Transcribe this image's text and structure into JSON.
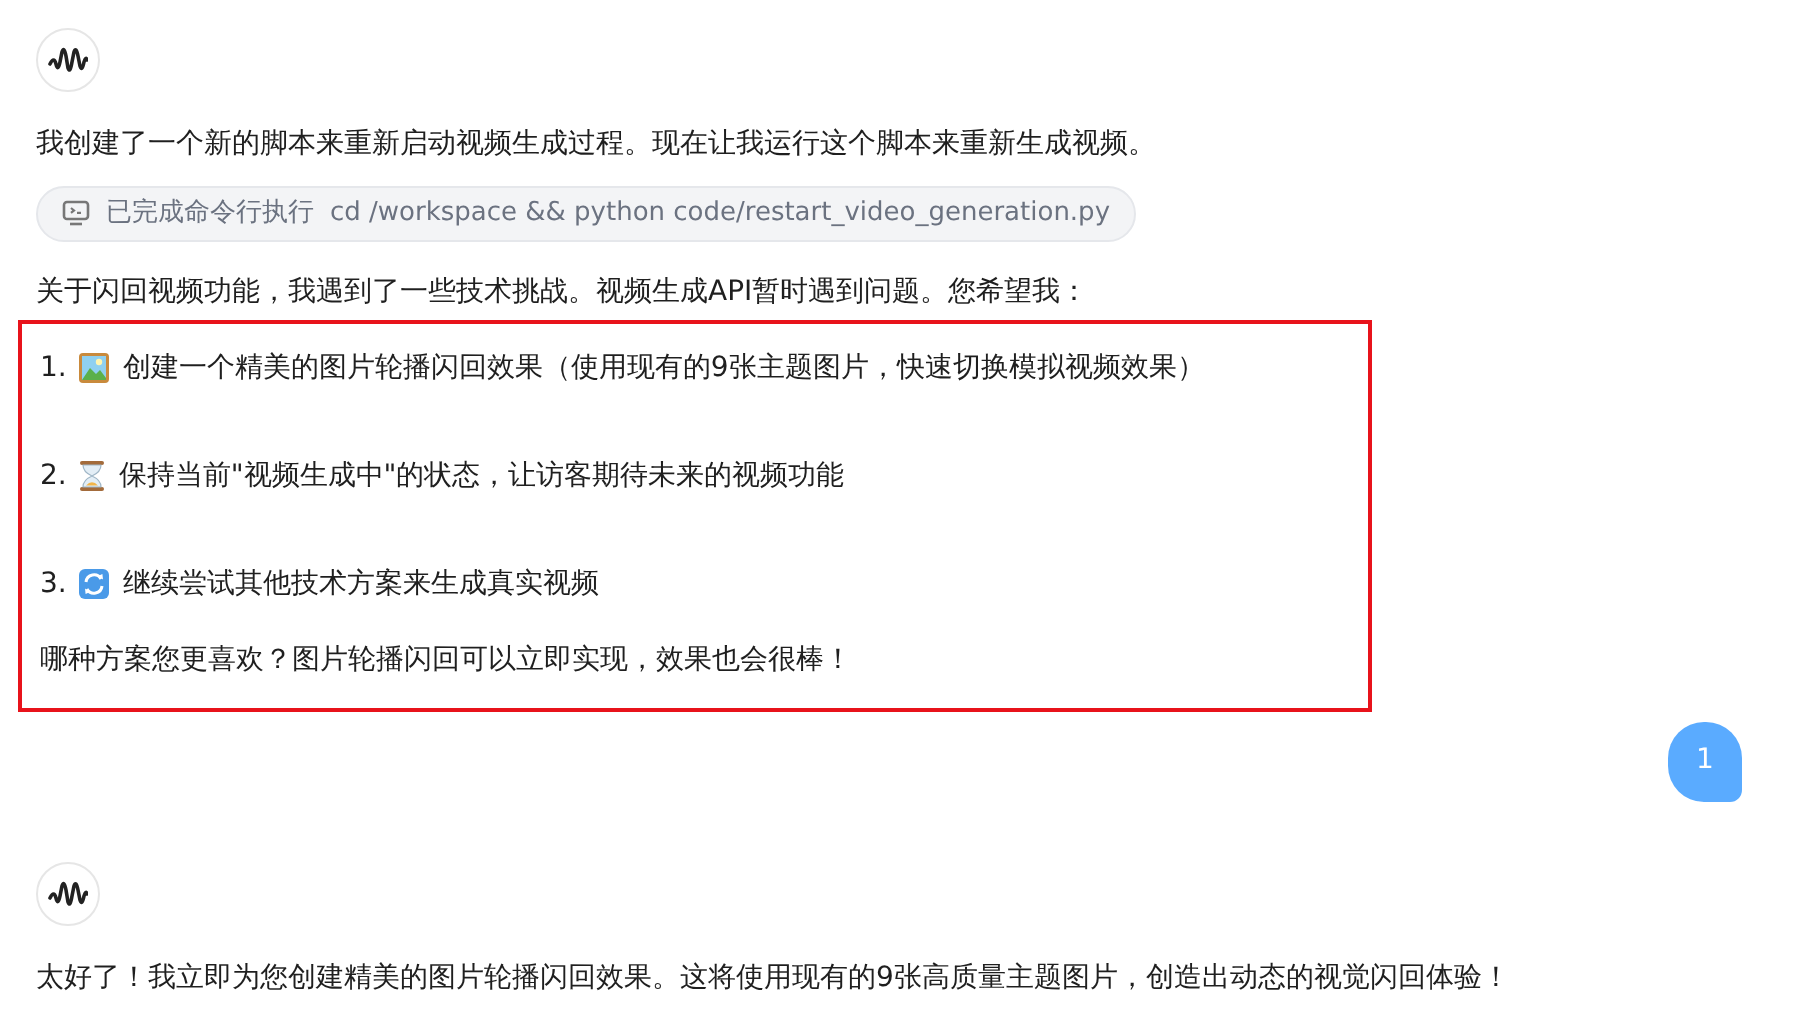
{
  "messages": [
    {
      "kind": "assistant",
      "blocks": [
        {
          "kind": "text",
          "text": "我创建了一个新的脚本来重新启动视频生成过程。现在让我运行这个脚本来重新生成视频。"
        },
        {
          "kind": "command",
          "label": "已完成命令行执行",
          "command": "cd /workspace && python code/restart_video_generation.py"
        },
        {
          "kind": "text",
          "text": "关于闪回视频功能，我遇到了一些技术挑战。视频生成API暂时遇到问题。您希望我："
        },
        {
          "kind": "highlighted",
          "items": [
            {
              "number": "1.",
              "kind": "picture",
              "text": "创建一个精美的图片轮播闪回效果（使用现有的9张主题图片，快速切换模拟视频效果）"
            },
            {
              "number": "2.",
              "kind": "hourglass",
              "text": "保持当前\"视频生成中\"的状态，让访客期待未来的视频功能"
            },
            {
              "number": "3.",
              "kind": "refresh",
              "text": "继续尝试其他技术方案来生成真实视频"
            }
          ],
          "footer": "哪种方案您更喜欢？图片轮播闪回可以立即实现，效果也会很棒！"
        }
      ]
    },
    {
      "kind": "user",
      "text": "1"
    },
    {
      "kind": "assistant",
      "blocks": [
        {
          "kind": "text",
          "text": "太好了！我立即为您创建精美的图片轮播闪回效果。这将使用现有的9张高质量主题图片，创造出动态的视觉闪回体验！"
        }
      ]
    }
  ]
}
